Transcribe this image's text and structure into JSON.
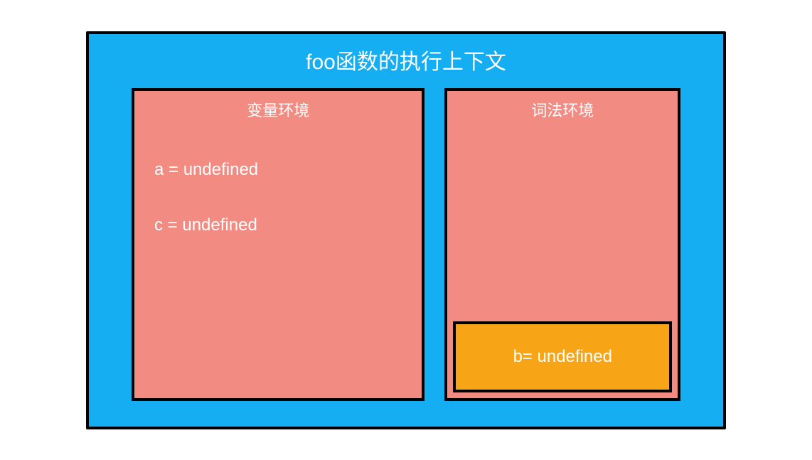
{
  "diagram": {
    "title": "foo函数的执行上下文",
    "variableEnvironment": {
      "title": "变量环境",
      "entries": {
        "a": "a = undefined",
        "c": "c = undefined"
      }
    },
    "lexicalEnvironment": {
      "title": "词法环境",
      "innerBox": {
        "b": "b= undefined"
      }
    }
  },
  "colors": {
    "outer": "#15aef3",
    "envBox": "#f28b82",
    "innerBox": "#f7a516",
    "border": "#000000",
    "text": "#ffffff"
  }
}
